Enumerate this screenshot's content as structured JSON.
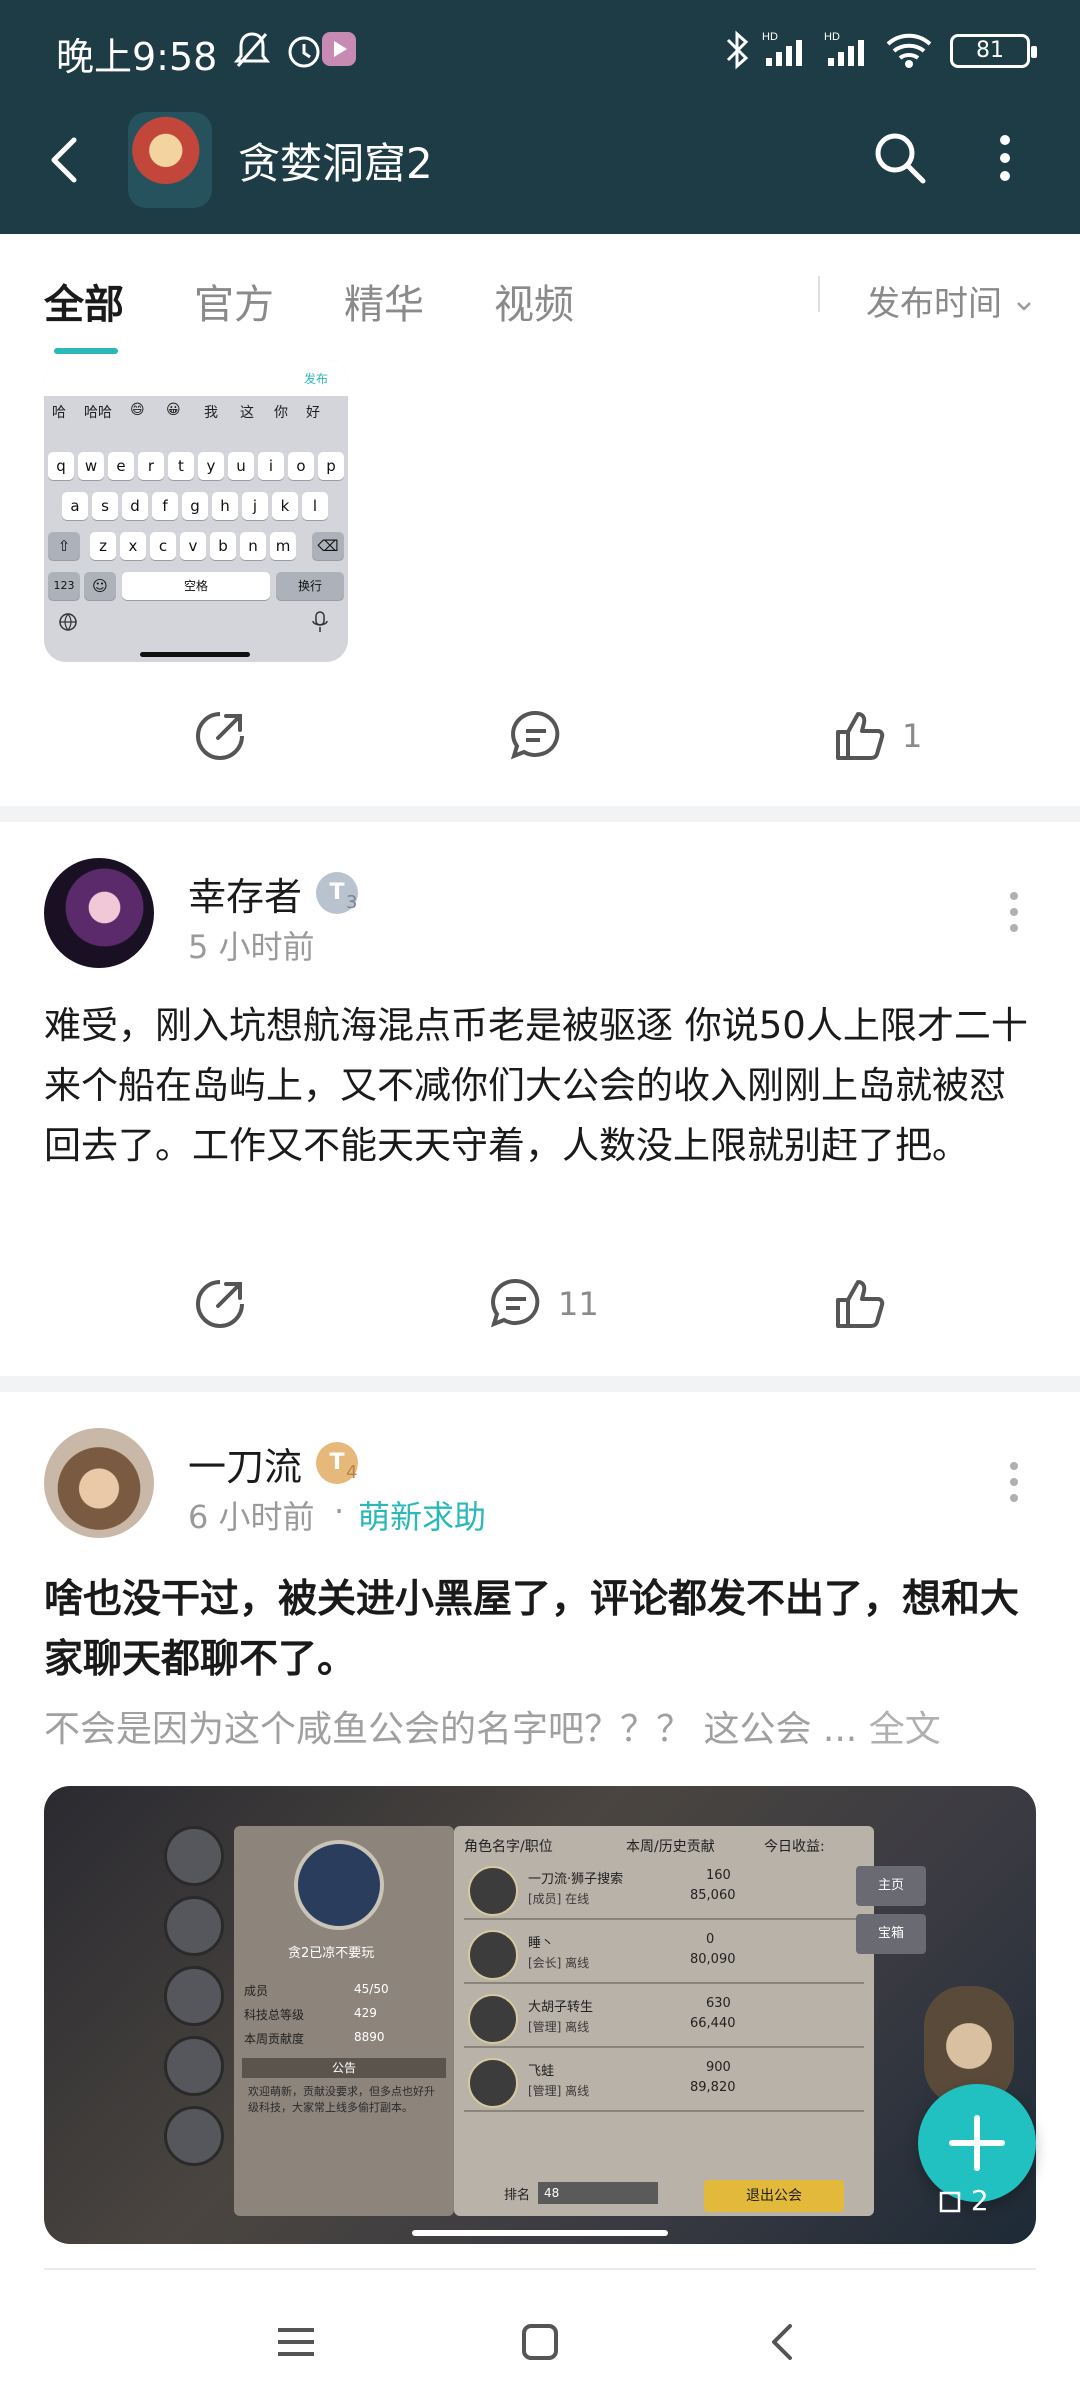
{
  "status_bar": {
    "time": "晚上9:58",
    "battery": "81"
  },
  "header": {
    "title": "贪婪洞窟2"
  },
  "tabs": [
    {
      "label": "全部",
      "active": true
    },
    {
      "label": "官方",
      "active": false
    },
    {
      "label": "精华",
      "active": false
    },
    {
      "label": "视频",
      "active": false
    }
  ],
  "sort_label": "发布时间",
  "keyboard_image": {
    "send_label": "发布",
    "candidates": [
      "哈",
      "哈哈",
      "😄",
      "😀",
      "我",
      "这",
      "你",
      "好"
    ],
    "row1": [
      "q",
      "w",
      "e",
      "r",
      "t",
      "y",
      "u",
      "i",
      "o",
      "p"
    ],
    "row2": [
      "a",
      "s",
      "d",
      "f",
      "g",
      "h",
      "j",
      "k",
      "l"
    ],
    "row3": [
      "z",
      "x",
      "c",
      "v",
      "b",
      "n",
      "m"
    ],
    "num_key": "123",
    "space_key": "空格",
    "return_key": "换行"
  },
  "post0": {
    "like_count": "1"
  },
  "post1": {
    "username": "幸存者",
    "badge": "T",
    "level": "3",
    "time": "5 小时前",
    "text": "难受，刚入坑想航海混点币老是被驱逐 你说50人上限才二十来个船在岛屿上，又不减你们大公会的收入刚刚上岛就被怼回去了。工作又不能天天守着，人数没上限就别赶了把。",
    "comment_count": "11"
  },
  "post2": {
    "username": "一刀流",
    "badge": "T",
    "level": "4",
    "time": "6 小时前",
    "dot": "·",
    "tag": "萌新求助",
    "title": "啥也没干过，被关进小黑屋了，评论都发不出了，想和大家聊天都聊不了。",
    "excerpt": "不会是因为这个咸鱼公会的名字吧？？？ 这公会",
    "ellipsis": "...",
    "full_text": "全文",
    "image_count": "2"
  },
  "game_image": {
    "guild_name": "贪2已凉不要玩",
    "stats": [
      {
        "label": "成员",
        "value": "45/50"
      },
      {
        "label": "科技总等级",
        "value": "429"
      },
      {
        "label": "本周贡献度",
        "value": "8890"
      }
    ],
    "notice_title": "公告",
    "notice_text": "欢迎萌新，贡献没要求，但多点也好升级科技，大家常上线多偷打副本。",
    "col_name": "角色名字/职位",
    "col_contrib": "本周/历史贡献",
    "col_income": "今日收益:",
    "members": [
      {
        "name": "一刀流·狮子搜索",
        "role": "[成员] 在线",
        "week": "160",
        "total": "85,060"
      },
      {
        "name": "睡丶",
        "role": "[会长] 离线",
        "week": "0",
        "total": "80,090"
      },
      {
        "name": "大胡子转生",
        "role": "[管理] 离线",
        "week": "630",
        "total": "66,440"
      },
      {
        "name": "飞蛙",
        "role": "[管理] 离线",
        "week": "900",
        "total": "89,820"
      }
    ],
    "rank_label": "排名",
    "rank_value": "48",
    "exit_button": "退出公会",
    "side_tabs": [
      "主页",
      "宝箱"
    ]
  },
  "colors": {
    "header_bg": "#1e3c46",
    "accent": "#2bb8b8",
    "fab": "#22c1c1"
  },
  "icons": [
    "back-icon",
    "search-icon",
    "more-vertical-icon",
    "share-icon",
    "comment-icon",
    "like-icon",
    "plus-icon",
    "menu-icon",
    "home-icon",
    "back-nav-icon"
  ]
}
